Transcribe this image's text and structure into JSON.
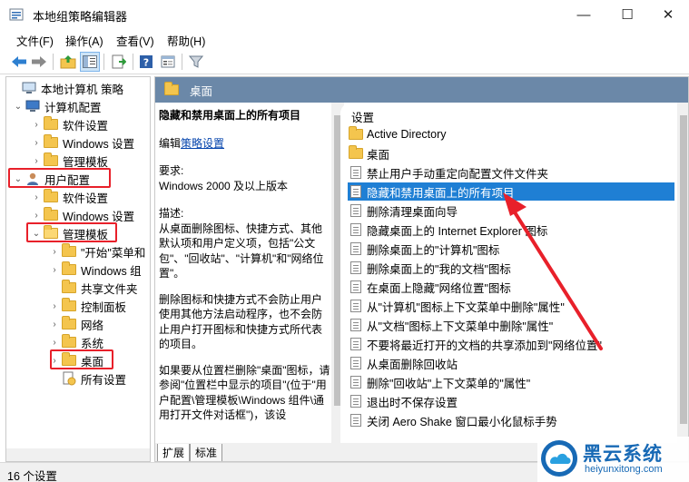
{
  "window": {
    "title": "本地组策略编辑器",
    "controls": {
      "minimize": "—",
      "maximize": "☐",
      "close": "✕"
    }
  },
  "menubar": [
    {
      "label": "文件(F)"
    },
    {
      "label": "操作(A)"
    },
    {
      "label": "查看(V)"
    },
    {
      "label": "帮助(H)"
    }
  ],
  "toolbar": {
    "icons": [
      "back-arrow-icon",
      "forward-arrow-icon",
      "up-folder-icon",
      "show-hide-tree-icon",
      "export-list-icon",
      "help-icon",
      "properties-icon",
      "filter-icon"
    ]
  },
  "tree": {
    "items": [
      {
        "label": "本地计算机 策略",
        "chevron": ""
      },
      {
        "label": "计算机配置",
        "chevron": "⌄"
      },
      {
        "label": "软件设置",
        "chevron": "›"
      },
      {
        "label": "Windows 设置",
        "chevron": "›"
      },
      {
        "label": "管理模板",
        "chevron": "›"
      },
      {
        "label": "用户配置",
        "chevron": "⌄"
      },
      {
        "label": "软件设置",
        "chevron": "›"
      },
      {
        "label": "Windows 设置",
        "chevron": "›"
      },
      {
        "label": "管理模板",
        "chevron": "⌄"
      },
      {
        "label": "\"开始\"菜单和",
        "chevron": "›"
      },
      {
        "label": "Windows 组",
        "chevron": "›"
      },
      {
        "label": "共享文件夹",
        "chevron": ""
      },
      {
        "label": "控制面板",
        "chevron": "›"
      },
      {
        "label": "网络",
        "chevron": "›"
      },
      {
        "label": "系统",
        "chevron": "›"
      },
      {
        "label": "桌面",
        "chevron": "›"
      },
      {
        "label": "所有设置",
        "chevron": ""
      }
    ]
  },
  "right_header": {
    "title": "桌面"
  },
  "description": {
    "title": "隐藏和禁用桌面上的所有项目",
    "edit_prefix": "编辑",
    "edit_link": "策略设置",
    "requirements_label": "要求:",
    "requirements_value": "Windows 2000 及以上版本",
    "desc_label": "描述:",
    "desc_p1": "从桌面删除图标、快捷方式、其他默认项和用户定义项，包括\"公文包\"、\"回收站\"、\"计算机\"和\"网络位置\"。",
    "desc_p2": "删除图标和快捷方式不会防止用户使用其他方法启动程序，也不会防止用户打开图标和快捷方式所代表的项目。",
    "desc_p3": "如果要从位置栏删除\"桌面\"图标，请参阅\"位置栏中显示的项目\"(位于\"用户配置\\管理模板\\Windows 组件\\通用打开文件对话框\")，该设"
  },
  "list": {
    "column_header": "设置",
    "items": [
      {
        "label": "Active Directory",
        "type": "folder"
      },
      {
        "label": "桌面",
        "type": "folder"
      },
      {
        "label": "禁止用户手动重定向配置文件文件夹",
        "type": "setting"
      },
      {
        "label": "隐藏和禁用桌面上的所有项目",
        "type": "setting",
        "selected": true
      },
      {
        "label": "删除清理桌面向导",
        "type": "setting"
      },
      {
        "label": "隐藏桌面上的 Internet Explorer 图标",
        "type": "setting"
      },
      {
        "label": "删除桌面上的\"计算机\"图标",
        "type": "setting"
      },
      {
        "label": "删除桌面上的\"我的文档\"图标",
        "type": "setting"
      },
      {
        "label": "在桌面上隐藏\"网络位置\"图标",
        "type": "setting"
      },
      {
        "label": "从\"计算机\"图标上下文菜单中删除\"属性\"",
        "type": "setting"
      },
      {
        "label": "从\"文档\"图标上下文菜单中删除\"属性\"",
        "type": "setting"
      },
      {
        "label": "不要将最近打开的文档的共享添加到\"网络位置\"",
        "type": "setting"
      },
      {
        "label": "从桌面删除回收站",
        "type": "setting"
      },
      {
        "label": "删除\"回收站\"上下文菜单的\"属性\"",
        "type": "setting"
      },
      {
        "label": "退出时不保存设置",
        "type": "setting"
      },
      {
        "label": "关闭 Aero Shake 窗口最小化鼠标手势",
        "type": "setting"
      }
    ]
  },
  "tabs": [
    {
      "label": "扩展"
    },
    {
      "label": "标准"
    }
  ],
  "status": {
    "text": "16 个设置"
  },
  "watermark": {
    "name": "黑云系统",
    "url": "heiyunxitong.com"
  },
  "colors": {
    "header_bg": "#6b88a8",
    "selected_bg": "#1f7fd4",
    "highlight_red": "#e8202a",
    "brand_blue": "#1769b5"
  }
}
